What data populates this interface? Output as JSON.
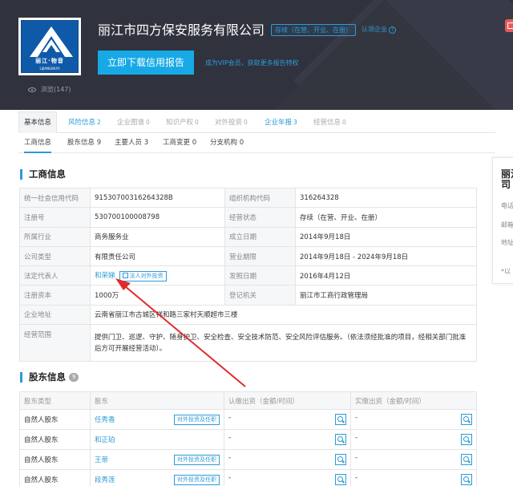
{
  "company": {
    "name": "丽江市四方保安服务有限公司",
    "status": "存续（在营、开业、在册）",
    "claim": "认领企业",
    "logo_text": "丽江·物音",
    "logo_sub": "LIJIANGWUYI"
  },
  "actions": {
    "download_label": "立即下载信用报告",
    "vip_text": "成为VIP会员，获取更多报告特权"
  },
  "views": {
    "label": "浏览(147)"
  },
  "tabs": [
    {
      "label": "基本信息",
      "count": ""
    },
    {
      "label": "风险信息",
      "count": "2"
    },
    {
      "label": "企业图谱",
      "count": "0"
    },
    {
      "label": "知识产权",
      "count": "0"
    },
    {
      "label": "对外投资",
      "count": "0"
    },
    {
      "label": "企业年报",
      "count": "3"
    },
    {
      "label": "经营信息",
      "count": "0"
    }
  ],
  "subtabs": [
    {
      "label": "工商信息"
    },
    {
      "label": "股东信息 9"
    },
    {
      "label": "主要人员 3"
    },
    {
      "label": "工商变更 0"
    },
    {
      "label": "分支机构 0"
    }
  ],
  "business_info": {
    "title": "工商信息",
    "rows": [
      {
        "l1": "统一社会信用代码",
        "v1": "91530700316264328B",
        "l2": "组织机构代码",
        "v2": "316264328"
      },
      {
        "l1": "注册号",
        "v1": "530700100008798",
        "l2": "经营状态",
        "v2": "存续（在营、开业、在册）"
      },
      {
        "l1": "所属行业",
        "v1": "商务服务业",
        "l2": "成立日期",
        "v2": "2014年9月18日"
      },
      {
        "l1": "公司类型",
        "v1": "有限责任公司",
        "l2": "营业期限",
        "v2": "2014年9月18日 - 2024年9月18日"
      },
      {
        "l1": "法定代表人",
        "v1": "和荣娣",
        "l2": "发照日期",
        "v2": "2016年4月12日"
      },
      {
        "l1": "注册资本",
        "v1": "1000万",
        "l2": "登记机关",
        "v2": "丽江市工商行政管理局"
      }
    ],
    "legal_rep_btn": "法人对外投资",
    "address_label": "企业地址",
    "address": "云南省丽江市古城区祥和路三家村天顺超市三楼",
    "scope_label": "经营范围",
    "scope": "提供门卫、巡逻、守护、随身护卫、安全检查、安全技术防范、安全风险评估服务。（依法须经批准的项目，经相关部门批准后方可开展经营活动）。"
  },
  "shareholders": {
    "title": "股东信息",
    "count": "9",
    "headers": [
      "股东类型",
      "股东",
      "认缴出资（金额/时间）",
      "实缴出资（金额/时间）"
    ],
    "btn_label": "对外投资及任职",
    "rows": [
      {
        "type": "自然人股东",
        "name": "任秀香",
        "btn": true,
        "sub": "-",
        "paid": "-"
      },
      {
        "type": "自然人股东",
        "name": "和正珀",
        "btn": false,
        "sub": "-",
        "paid": "-"
      },
      {
        "type": "自然人股东",
        "name": "王蒂",
        "btn": true,
        "sub": "-",
        "paid": "-"
      },
      {
        "type": "自然人股东",
        "name": "段秀莲",
        "btn": true,
        "sub": "-",
        "paid": "-"
      }
    ]
  },
  "right_card": {
    "title": "丽江司",
    "lines": [
      "电话",
      "邮箱",
      "地址",
      "*以"
    ]
  },
  "colors": {
    "accent": "#2d9bd6",
    "header_bg": "#30323e",
    "download_btn": "#17a9e6",
    "annotation_arrow": "#e02b2b"
  }
}
